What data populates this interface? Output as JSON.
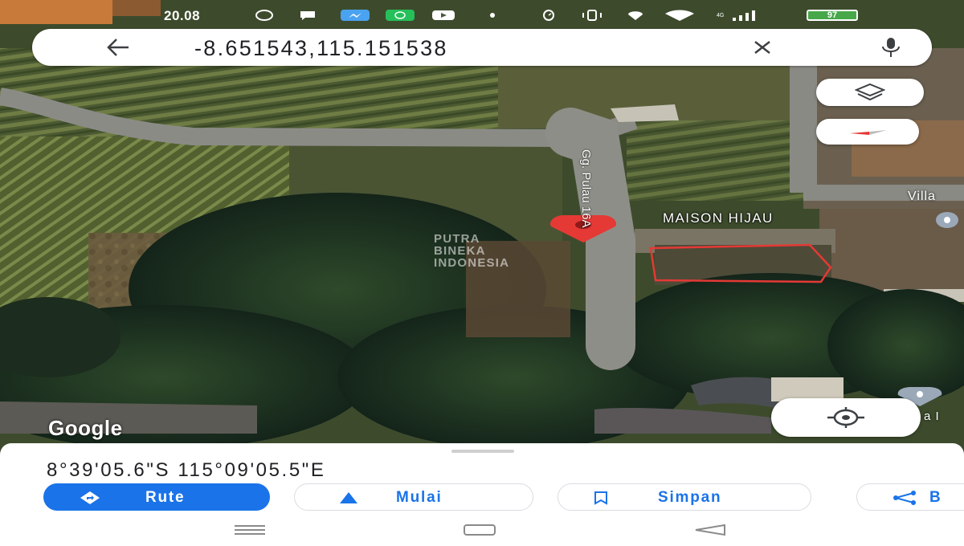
{
  "status_bar": {
    "time": "20.08",
    "battery": "97",
    "icons": [
      "messenger-icon",
      "chat-icon",
      "whatsapp-icon",
      "youtube-icon",
      "dot-icon",
      "alarm-icon",
      "vibrate-icon",
      "location-icon",
      "wifi-icon",
      "signal-icon"
    ]
  },
  "search": {
    "query": "-8.651543,115.151538"
  },
  "map": {
    "road_label": "Gg. Pulau 16A",
    "place_label": "MAISON HIJAU",
    "place_label_2": "Villa",
    "place_label_3": "a I",
    "watermark": [
      "PUTRA",
      "BINEKA",
      "INDONESIA"
    ],
    "attribution": "Google"
  },
  "sheet": {
    "coordinates": "8°39'05.6\"S 115°09'05.5\"E",
    "actions": [
      {
        "label": "Rute",
        "icon": "directions-icon"
      },
      {
        "label": "Mulai",
        "icon": "navigation-arrow-icon"
      },
      {
        "label": "Simpan",
        "icon": "bookmark-icon"
      },
      {
        "label": "B",
        "icon": "share-icon"
      }
    ]
  },
  "colors": {
    "accent": "#1a73e8",
    "pin": "#e53935",
    "parcel_outline": "#e53935"
  }
}
